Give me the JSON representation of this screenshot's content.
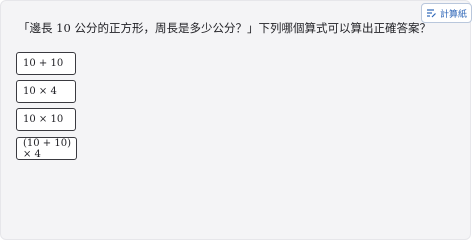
{
  "toolbar": {
    "scratchpad_label": "計算紙",
    "scratchpad_icon": "pencil-lines-icon"
  },
  "question": {
    "prefix": "「邊長 ",
    "number": "10",
    "suffix": " 公分的正方形，周長是多少公分？」下列哪個算式可以算出正確答案？"
  },
  "choices": [
    {
      "label": "10 + 10"
    },
    {
      "label": "10 × 4"
    },
    {
      "label": "10 × 10"
    },
    {
      "label": "(10 + 10) × 4"
    }
  ],
  "colors": {
    "panel_background": "#f4f4f6",
    "accent": "#2f67b8",
    "choice_border": "#3a3a40"
  }
}
